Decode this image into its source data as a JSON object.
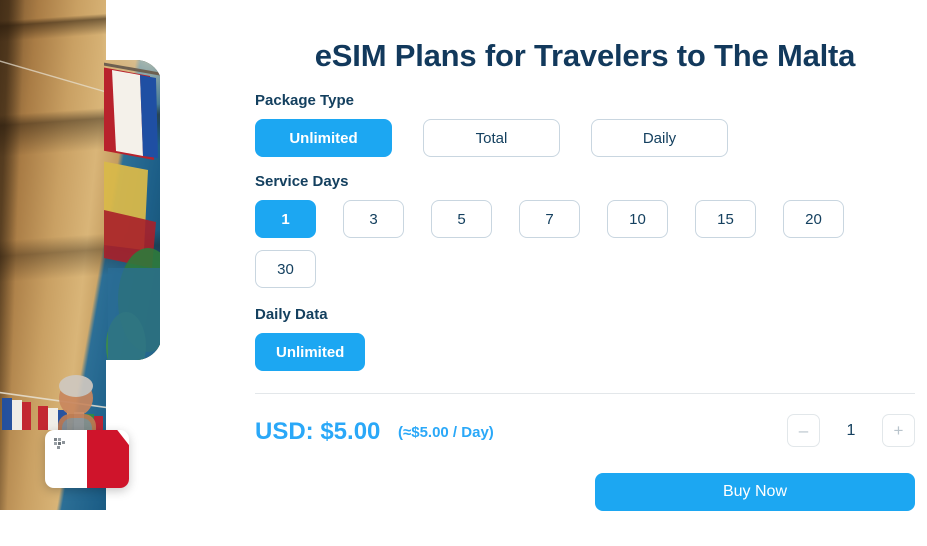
{
  "header": {
    "title": "eSIM Plans for Travelers to The Malta"
  },
  "hero": {
    "image_alt": "malta-street-scene-photo",
    "flag_badge": "malta-flag"
  },
  "package_type": {
    "label": "Package Type",
    "selected": "Unlimited",
    "options": [
      {
        "label": "Unlimited",
        "selected": true
      },
      {
        "label": "Total",
        "selected": false
      },
      {
        "label": "Daily",
        "selected": false
      }
    ]
  },
  "service_days": {
    "label": "Service Days",
    "selected": "1",
    "options": [
      {
        "label": "1",
        "selected": true
      },
      {
        "label": "3",
        "selected": false
      },
      {
        "label": "5",
        "selected": false
      },
      {
        "label": "7",
        "selected": false
      },
      {
        "label": "10",
        "selected": false
      },
      {
        "label": "15",
        "selected": false
      },
      {
        "label": "20",
        "selected": false
      },
      {
        "label": "30",
        "selected": false
      }
    ]
  },
  "daily_data": {
    "label": "Daily Data",
    "selected": "Unlimited",
    "options": [
      {
        "label": "Unlimited",
        "selected": true
      }
    ]
  },
  "price": {
    "main": "USD: $5.00",
    "per_day": "(≈$5.00 / Day)"
  },
  "quantity": {
    "value": "1",
    "decrement_label": "–",
    "increment_label": "+"
  },
  "actions": {
    "buy_now": "Buy Now"
  },
  "colors": {
    "accent_blue": "#1ca7f2",
    "price_blue": "#2aa8f8",
    "text_navy": "#14405f",
    "border_grey": "#c9d6e0",
    "divider_grey": "#e3e7ea",
    "flag_red": "#cf142b"
  }
}
